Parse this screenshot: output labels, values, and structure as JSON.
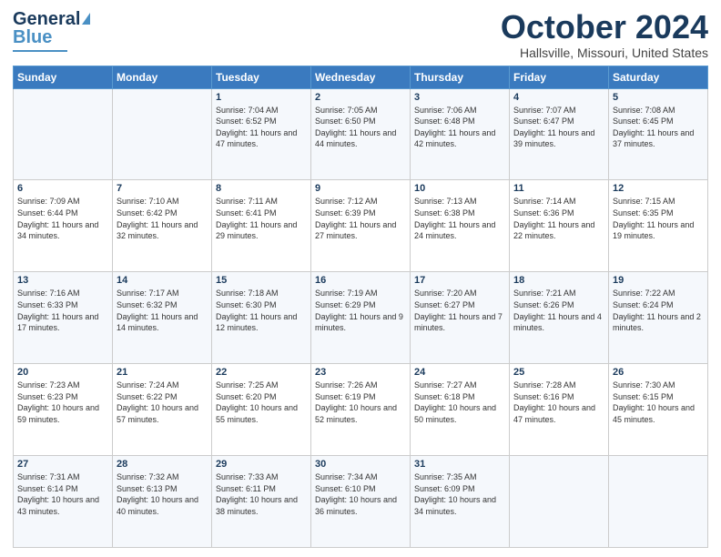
{
  "header": {
    "logo_general": "General",
    "logo_blue": "Blue",
    "month_title": "October 2024",
    "location": "Hallsville, Missouri, United States"
  },
  "weekdays": [
    "Sunday",
    "Monday",
    "Tuesday",
    "Wednesday",
    "Thursday",
    "Friday",
    "Saturday"
  ],
  "weeks": [
    [
      {
        "day": "",
        "sunrise": "",
        "sunset": "",
        "daylight": ""
      },
      {
        "day": "",
        "sunrise": "",
        "sunset": "",
        "daylight": ""
      },
      {
        "day": "1",
        "sunrise": "Sunrise: 7:04 AM",
        "sunset": "Sunset: 6:52 PM",
        "daylight": "Daylight: 11 hours and 47 minutes."
      },
      {
        "day": "2",
        "sunrise": "Sunrise: 7:05 AM",
        "sunset": "Sunset: 6:50 PM",
        "daylight": "Daylight: 11 hours and 44 minutes."
      },
      {
        "day": "3",
        "sunrise": "Sunrise: 7:06 AM",
        "sunset": "Sunset: 6:48 PM",
        "daylight": "Daylight: 11 hours and 42 minutes."
      },
      {
        "day": "4",
        "sunrise": "Sunrise: 7:07 AM",
        "sunset": "Sunset: 6:47 PM",
        "daylight": "Daylight: 11 hours and 39 minutes."
      },
      {
        "day": "5",
        "sunrise": "Sunrise: 7:08 AM",
        "sunset": "Sunset: 6:45 PM",
        "daylight": "Daylight: 11 hours and 37 minutes."
      }
    ],
    [
      {
        "day": "6",
        "sunrise": "Sunrise: 7:09 AM",
        "sunset": "Sunset: 6:44 PM",
        "daylight": "Daylight: 11 hours and 34 minutes."
      },
      {
        "day": "7",
        "sunrise": "Sunrise: 7:10 AM",
        "sunset": "Sunset: 6:42 PM",
        "daylight": "Daylight: 11 hours and 32 minutes."
      },
      {
        "day": "8",
        "sunrise": "Sunrise: 7:11 AM",
        "sunset": "Sunset: 6:41 PM",
        "daylight": "Daylight: 11 hours and 29 minutes."
      },
      {
        "day": "9",
        "sunrise": "Sunrise: 7:12 AM",
        "sunset": "Sunset: 6:39 PM",
        "daylight": "Daylight: 11 hours and 27 minutes."
      },
      {
        "day": "10",
        "sunrise": "Sunrise: 7:13 AM",
        "sunset": "Sunset: 6:38 PM",
        "daylight": "Daylight: 11 hours and 24 minutes."
      },
      {
        "day": "11",
        "sunrise": "Sunrise: 7:14 AM",
        "sunset": "Sunset: 6:36 PM",
        "daylight": "Daylight: 11 hours and 22 minutes."
      },
      {
        "day": "12",
        "sunrise": "Sunrise: 7:15 AM",
        "sunset": "Sunset: 6:35 PM",
        "daylight": "Daylight: 11 hours and 19 minutes."
      }
    ],
    [
      {
        "day": "13",
        "sunrise": "Sunrise: 7:16 AM",
        "sunset": "Sunset: 6:33 PM",
        "daylight": "Daylight: 11 hours and 17 minutes."
      },
      {
        "day": "14",
        "sunrise": "Sunrise: 7:17 AM",
        "sunset": "Sunset: 6:32 PM",
        "daylight": "Daylight: 11 hours and 14 minutes."
      },
      {
        "day": "15",
        "sunrise": "Sunrise: 7:18 AM",
        "sunset": "Sunset: 6:30 PM",
        "daylight": "Daylight: 11 hours and 12 minutes."
      },
      {
        "day": "16",
        "sunrise": "Sunrise: 7:19 AM",
        "sunset": "Sunset: 6:29 PM",
        "daylight": "Daylight: 11 hours and 9 minutes."
      },
      {
        "day": "17",
        "sunrise": "Sunrise: 7:20 AM",
        "sunset": "Sunset: 6:27 PM",
        "daylight": "Daylight: 11 hours and 7 minutes."
      },
      {
        "day": "18",
        "sunrise": "Sunrise: 7:21 AM",
        "sunset": "Sunset: 6:26 PM",
        "daylight": "Daylight: 11 hours and 4 minutes."
      },
      {
        "day": "19",
        "sunrise": "Sunrise: 7:22 AM",
        "sunset": "Sunset: 6:24 PM",
        "daylight": "Daylight: 11 hours and 2 minutes."
      }
    ],
    [
      {
        "day": "20",
        "sunrise": "Sunrise: 7:23 AM",
        "sunset": "Sunset: 6:23 PM",
        "daylight": "Daylight: 10 hours and 59 minutes."
      },
      {
        "day": "21",
        "sunrise": "Sunrise: 7:24 AM",
        "sunset": "Sunset: 6:22 PM",
        "daylight": "Daylight: 10 hours and 57 minutes."
      },
      {
        "day": "22",
        "sunrise": "Sunrise: 7:25 AM",
        "sunset": "Sunset: 6:20 PM",
        "daylight": "Daylight: 10 hours and 55 minutes."
      },
      {
        "day": "23",
        "sunrise": "Sunrise: 7:26 AM",
        "sunset": "Sunset: 6:19 PM",
        "daylight": "Daylight: 10 hours and 52 minutes."
      },
      {
        "day": "24",
        "sunrise": "Sunrise: 7:27 AM",
        "sunset": "Sunset: 6:18 PM",
        "daylight": "Daylight: 10 hours and 50 minutes."
      },
      {
        "day": "25",
        "sunrise": "Sunrise: 7:28 AM",
        "sunset": "Sunset: 6:16 PM",
        "daylight": "Daylight: 10 hours and 47 minutes."
      },
      {
        "day": "26",
        "sunrise": "Sunrise: 7:30 AM",
        "sunset": "Sunset: 6:15 PM",
        "daylight": "Daylight: 10 hours and 45 minutes."
      }
    ],
    [
      {
        "day": "27",
        "sunrise": "Sunrise: 7:31 AM",
        "sunset": "Sunset: 6:14 PM",
        "daylight": "Daylight: 10 hours and 43 minutes."
      },
      {
        "day": "28",
        "sunrise": "Sunrise: 7:32 AM",
        "sunset": "Sunset: 6:13 PM",
        "daylight": "Daylight: 10 hours and 40 minutes."
      },
      {
        "day": "29",
        "sunrise": "Sunrise: 7:33 AM",
        "sunset": "Sunset: 6:11 PM",
        "daylight": "Daylight: 10 hours and 38 minutes."
      },
      {
        "day": "30",
        "sunrise": "Sunrise: 7:34 AM",
        "sunset": "Sunset: 6:10 PM",
        "daylight": "Daylight: 10 hours and 36 minutes."
      },
      {
        "day": "31",
        "sunrise": "Sunrise: 7:35 AM",
        "sunset": "Sunset: 6:09 PM",
        "daylight": "Daylight: 10 hours and 34 minutes."
      },
      {
        "day": "",
        "sunrise": "",
        "sunset": "",
        "daylight": ""
      },
      {
        "day": "",
        "sunrise": "",
        "sunset": "",
        "daylight": ""
      }
    ]
  ]
}
